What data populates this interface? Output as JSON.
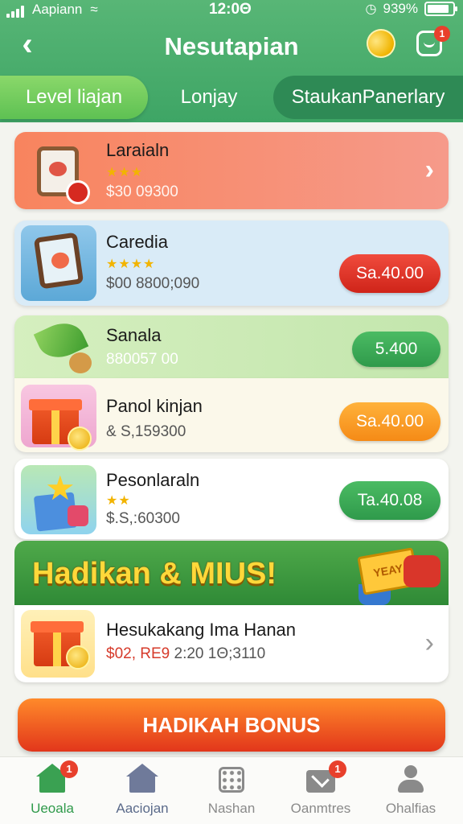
{
  "status_bar": {
    "carrier": "Aapiann",
    "time": "12:0Θ",
    "battery": "939%"
  },
  "header": {
    "title": "Nesutapian",
    "message_badge": "1"
  },
  "tabs": [
    {
      "label": "Level liajan"
    },
    {
      "label": "Lonjay"
    },
    {
      "label": "StaukanPanerlary"
    }
  ],
  "items": [
    {
      "name": "Laraialn",
      "stars": "★★★",
      "price": "$30 09300",
      "bg": "#f7806a"
    },
    {
      "name": "Caredia",
      "stars": "★★★★",
      "price": "$00 8800;090",
      "button": "Sa.40.00",
      "bg": "#d7e9f6"
    },
    {
      "name": "Sanala",
      "price": "880057 00",
      "button": "5.400",
      "bg": "#cbe9b8"
    },
    {
      "name": "Panol kinjan",
      "price": "& S,159300",
      "button": "Sa.40.00",
      "bg": "#fbf8ea"
    },
    {
      "name": "Pesonlaraln",
      "stars": "★★",
      "price": "$.S,:60300",
      "button": "Ta.40.08",
      "bg": "#ffffff"
    }
  ],
  "banner": {
    "text": "Hadikan & MIUS!",
    "ticket_text": "YEAY"
  },
  "bonus_item": {
    "name": "Hesukakang Ima Hanan",
    "price_red": "$02, RE9",
    "price_rest": " 2:20 1Θ;3110"
  },
  "cta": {
    "label": "HADIKAH BONUS"
  },
  "bottom_nav": [
    {
      "label": "Ueoala",
      "badge": "1"
    },
    {
      "label": "Aaciojan"
    },
    {
      "label": "Nashan"
    },
    {
      "label": "Oanmtres",
      "badge": "1"
    },
    {
      "label": "Ohalfias"
    }
  ],
  "colors": {
    "header_green": "#3ea565",
    "accent_red": "#cf2419",
    "accent_green": "#2f9a4b",
    "accent_orange": "#f58a16",
    "cta_orange": "#e2361b"
  }
}
